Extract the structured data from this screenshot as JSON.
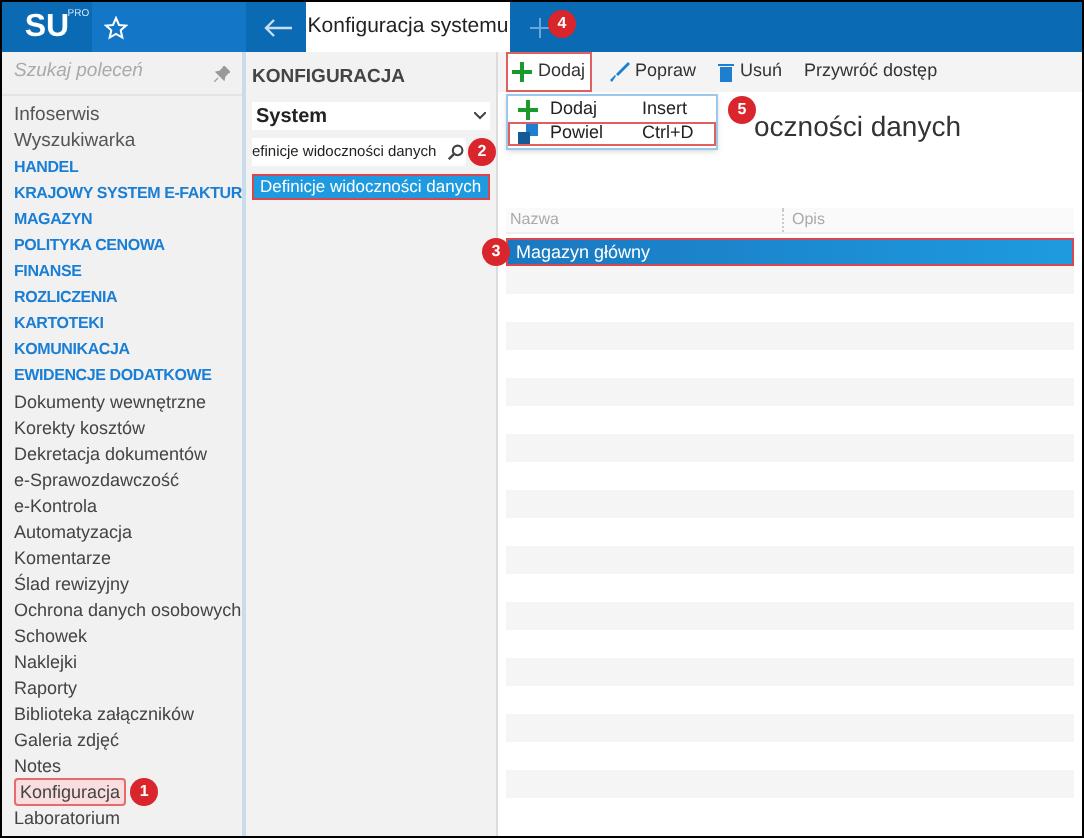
{
  "header": {
    "logo": "SU",
    "logo_badge": "PRO",
    "tab": {
      "label": "Konfiguracja systemu",
      "selected": true
    }
  },
  "sidebar": {
    "search": {
      "placeholder": "Szukaj poleceń"
    },
    "items": [
      {
        "label": "Infoserwis",
        "kind": "plain",
        "selected": false
      },
      {
        "label": "Wyszukiwarka",
        "kind": "plain",
        "selected": false
      },
      {
        "label": "HANDEL",
        "kind": "section",
        "selected": false
      },
      {
        "label": "KRAJOWY SYSTEM E-FAKTUR",
        "kind": "section",
        "selected": false
      },
      {
        "label": "MAGAZYN",
        "kind": "section",
        "selected": false
      },
      {
        "label": "POLITYKA CENOWA",
        "kind": "section",
        "selected": false
      },
      {
        "label": "FINANSE",
        "kind": "section",
        "selected": false
      },
      {
        "label": "ROZLICZENIA",
        "kind": "section",
        "selected": false
      },
      {
        "label": "KARTOTEKI",
        "kind": "section",
        "selected": false
      },
      {
        "label": "KOMUNIKACJA",
        "kind": "section",
        "selected": false
      },
      {
        "label": "EWIDENCJE DODATKOWE",
        "kind": "section",
        "selected": false,
        "children": [
          {
            "label": "Dokumenty wewnętrzne",
            "selected": false
          },
          {
            "label": "Korekty kosztów",
            "selected": false
          },
          {
            "label": "Dekretacja dokumentów",
            "selected": false
          },
          {
            "label": "e-Sprawozdawczość",
            "selected": false
          },
          {
            "label": "e-Kontrola",
            "selected": false
          },
          {
            "label": "Automatyzacja",
            "selected": false
          },
          {
            "label": "Komentarze",
            "selected": false
          },
          {
            "label": "Ślad rewizyjny",
            "selected": false
          },
          {
            "label": "Ochrona danych osobowych",
            "selected": false
          },
          {
            "label": "Schowek",
            "selected": false
          },
          {
            "label": "Naklejki",
            "selected": false
          },
          {
            "label": "Raporty",
            "selected": false
          },
          {
            "label": "Biblioteka załączników",
            "selected": false
          },
          {
            "label": "Galeria zdjęć",
            "selected": false
          },
          {
            "label": "Notes",
            "selected": false
          },
          {
            "label": "Konfiguracja",
            "selected": true,
            "badge": "1"
          },
          {
            "label": "Laboratorium",
            "selected": false
          }
        ]
      }
    ]
  },
  "config_panel": {
    "title": "KONFIGURACJA",
    "dropdown": "System",
    "search": {
      "value": "efinicje widoczności danych",
      "badge": "2"
    },
    "results": [
      {
        "label": "Definicje widoczności danych",
        "selected": true
      }
    ]
  },
  "toolbar": {
    "add_tab_badge": "4",
    "buttons": [
      {
        "label": "Dodaj",
        "kind": "add",
        "highlighted": true
      },
      {
        "label": "Popraw",
        "kind": "edit",
        "highlighted": false
      },
      {
        "label": "Usuń",
        "kind": "delete",
        "highlighted": false
      },
      {
        "label": "Przywróć dostęp",
        "kind": "restore",
        "highlighted": false
      }
    ]
  },
  "menu": {
    "badge": "5",
    "items": [
      {
        "label": "Dodaj",
        "shortcut": "Insert",
        "kind": "add",
        "highlighted": false
      },
      {
        "label": "Powiel",
        "shortcut": "Ctrl+D",
        "kind": "copy",
        "highlighted": true
      }
    ]
  },
  "content": {
    "heading": "oczności danych",
    "table": {
      "columns": [
        "Nazwa",
        "Opis"
      ],
      "rows": [
        {
          "cells": [
            "Magazyn główny"
          ],
          "selected": true,
          "badge": "3"
        }
      ]
    }
  }
}
